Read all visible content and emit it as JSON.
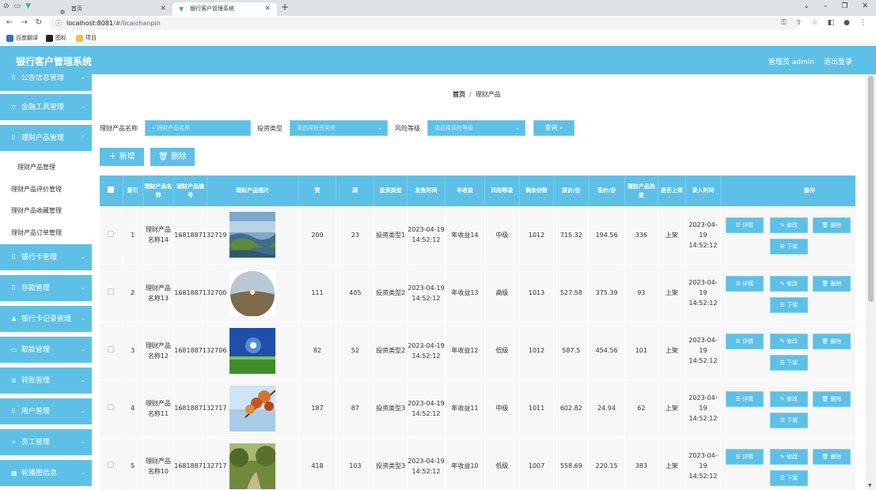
{
  "browser": {
    "tabs": [
      {
        "title": "首页"
      },
      {
        "title": "银行客户管理系统"
      }
    ],
    "url": {
      "host": "localhost:8081",
      "path": "/#/licaichanpin"
    },
    "bookmarks": [
      {
        "label": "百度翻译",
        "color": "#2f6fd6"
      },
      {
        "label": "图标",
        "color": "#222222"
      },
      {
        "label": "项目",
        "color": "#f2c04b"
      }
    ]
  },
  "header": {
    "title": "银行客户管理系统",
    "user": "管理员 admin",
    "logout": "退出登录"
  },
  "sidebar": {
    "menus": [
      {
        "label": "公告信息管理"
      },
      {
        "label": "金融工具管理"
      },
      {
        "label": "理财产品管理"
      },
      {
        "label": "银行卡管理"
      },
      {
        "label": "存款管理"
      },
      {
        "label": "银行卡记录管理"
      },
      {
        "label": "取款管理"
      },
      {
        "label": "转账管理"
      },
      {
        "label": "用户管理"
      },
      {
        "label": "员工管理"
      },
      {
        "label": "轮播图信息"
      }
    ],
    "submenu": [
      {
        "label": "理财产品管理"
      },
      {
        "label": "理财产品评价管理"
      },
      {
        "label": "理财产品收藏管理"
      },
      {
        "label": "理财产品订单管理"
      }
    ]
  },
  "breadcrumb": {
    "home": "首页",
    "separator": "/",
    "current": "理财产品"
  },
  "filters": {
    "name_label": "理财产品名称",
    "name_placeholder": "理财产品名称",
    "type_label": "投资类型",
    "type_placeholder": "请选择投资类型",
    "risk_label": "风险等级",
    "risk_placeholder": "请选择风险等级",
    "query_label": "查询"
  },
  "actions": {
    "add": "新增",
    "delete": "删除"
  },
  "table": {
    "headers": [
      "",
      "索引",
      "理财产品名称",
      "理财产品编号",
      "理财产品图片",
      "赞",
      "踩",
      "投资类型",
      "发售时间",
      "年收益",
      "风险等级",
      "剩余份数",
      "原价/份",
      "现价/份",
      "理财产品热度",
      "是否上架",
      "录入时间",
      "操作"
    ],
    "op_labels": {
      "detail": "详情",
      "edit": "修改",
      "delete": "删除",
      "offshelf": "下架"
    },
    "rows": [
      {
        "index": "1",
        "name": "理财产品名称14",
        "code": "1681887132719",
        "img": "marsh",
        "like": "209",
        "dislike": "23",
        "type": "投资类型1",
        "sale_time": "2023-04-19 14:52:12",
        "yield": "年收益14",
        "risk": "中级",
        "remaining": "1012",
        "orig_price": "715.32",
        "cur_price": "194.56",
        "heat": "336",
        "shelf": "上架",
        "entry_time": "2023-04-19 14:52:12"
      },
      {
        "index": "2",
        "name": "理财产品名称13",
        "code": "1681887132700",
        "img": "sphere",
        "like": "111",
        "dislike": "405",
        "type": "投资类型2",
        "sale_time": "2023-04-19 14:52:12",
        "yield": "年收益13",
        "risk": "高级",
        "remaining": "1013",
        "orig_price": "527.58",
        "cur_price": "375.39",
        "heat": "93",
        "shelf": "上架",
        "entry_time": "2023-04-19 14:52:12"
      },
      {
        "index": "3",
        "name": "理财产品名称12",
        "code": "1681887132706",
        "img": "field",
        "like": "82",
        "dislike": "52",
        "type": "投资类型2",
        "sale_time": "2023-04-19 14:52:12",
        "yield": "年收益12",
        "risk": "低级",
        "remaining": "1012",
        "orig_price": "587.5",
        "cur_price": "454.56",
        "heat": "101",
        "shelf": "上架",
        "entry_time": "2023-04-19 14:52:12"
      },
      {
        "index": "4",
        "name": "理财产品名称11",
        "code": "1681887132717",
        "img": "leaves",
        "like": "187",
        "dislike": "87",
        "type": "投资类型3",
        "sale_time": "2023-04-19 14:52:12",
        "yield": "年收益11",
        "risk": "中级",
        "remaining": "1011",
        "orig_price": "602.82",
        "cur_price": "24.94",
        "heat": "62",
        "shelf": "上架",
        "entry_time": "2023-04-19 14:52:12"
      },
      {
        "index": "5",
        "name": "理财产品名称10",
        "code": "1681887132717",
        "img": "forest",
        "like": "418",
        "dislike": "103",
        "type": "投资类型3",
        "sale_time": "2023-04-19 14:52:12",
        "yield": "年收益10",
        "risk": "低级",
        "remaining": "1007",
        "orig_price": "558.69",
        "cur_price": "220.15",
        "heat": "383",
        "shelf": "上架",
        "entry_time": "2023-04-19 14:52:12"
      }
    ]
  },
  "colors": {
    "accent": "#5ec0e6",
    "row_bg": "#f7f7f7"
  }
}
